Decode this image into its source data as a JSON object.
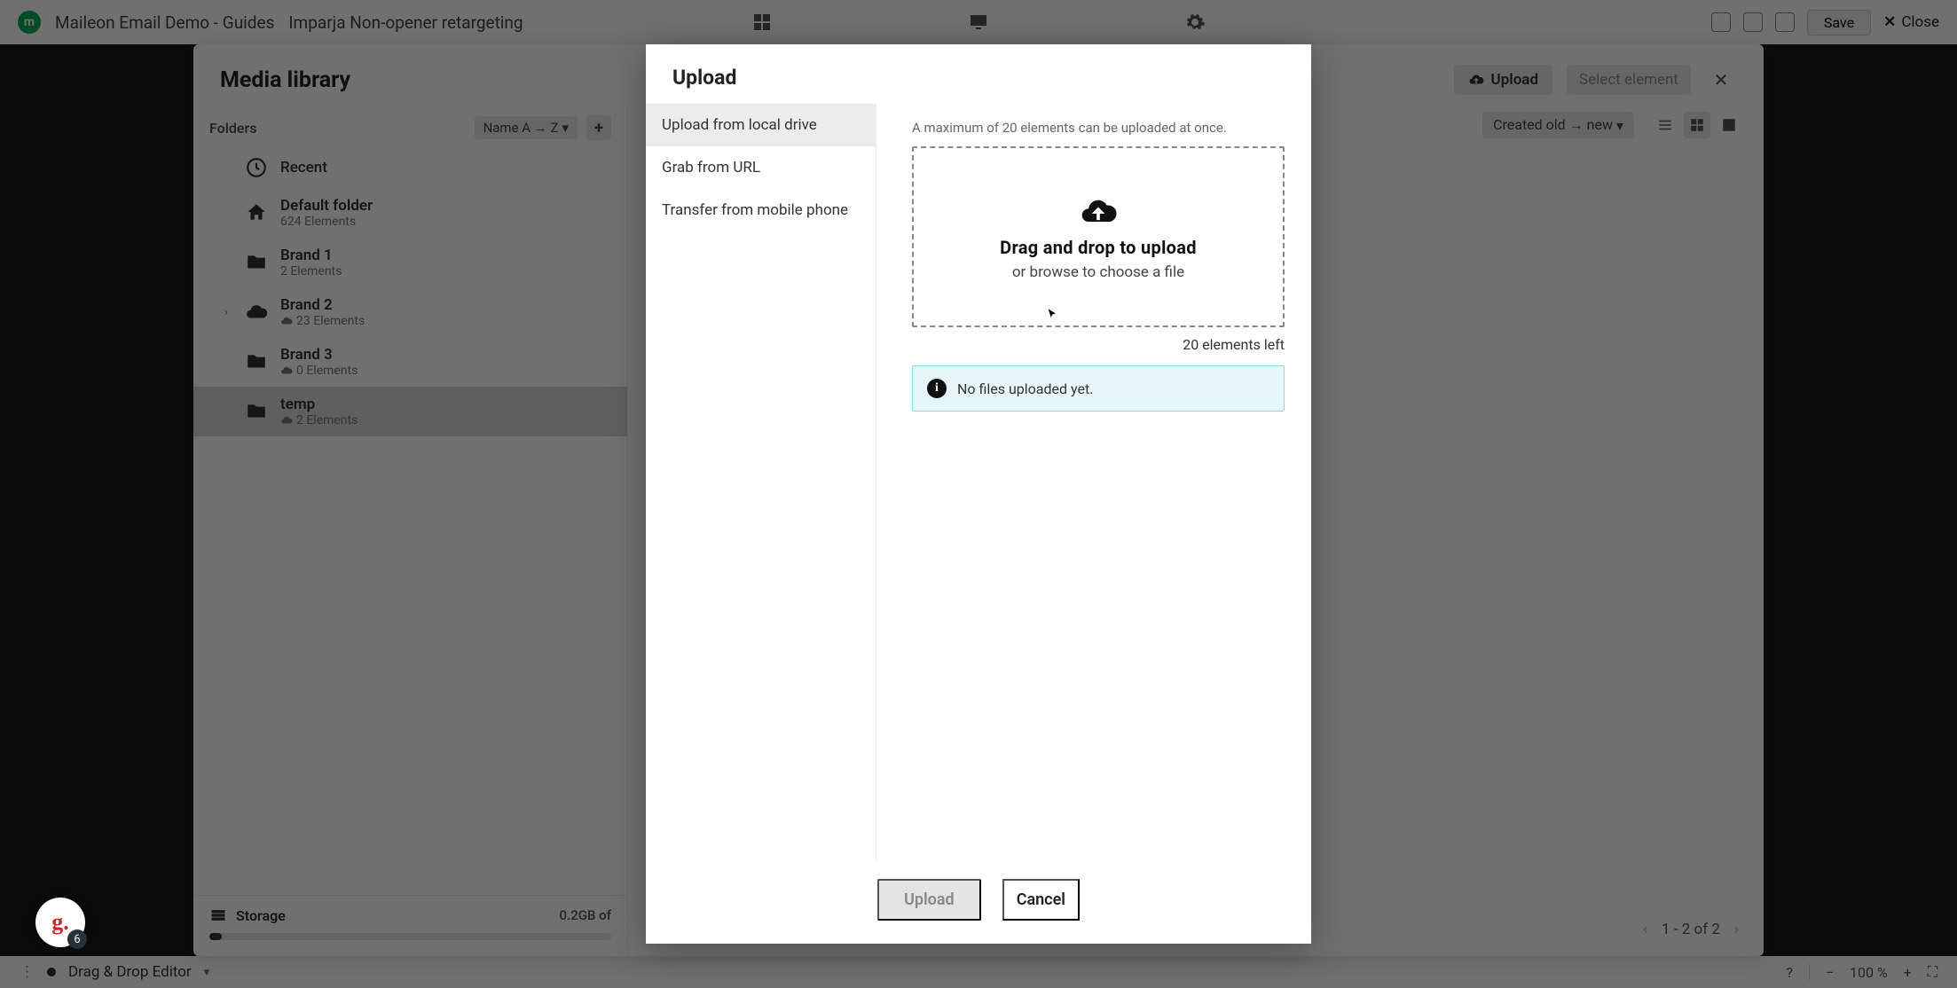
{
  "topbar": {
    "crumb1": "Maileon Email Demo - Guides",
    "crumb2": "Imparja Non-opener retargeting",
    "save": "Save",
    "close": "Close"
  },
  "bottombar": {
    "editor": "Drag & Drop Editor",
    "zoom": "100 %"
  },
  "panel": {
    "title": "Media library",
    "upload_btn": "Upload",
    "select_btn": "Select element"
  },
  "sidebar": {
    "folders_label": "Folders",
    "sort": "Name A → Z",
    "recent": "Recent",
    "items": [
      {
        "name": "Default folder",
        "meta": "624 Elements",
        "icon": "home"
      },
      {
        "name": "Brand 1",
        "meta": "2 Elements",
        "icon": "folder"
      },
      {
        "name": "Brand 2",
        "meta": "23 Elements",
        "icon": "cloud",
        "expandable": true
      },
      {
        "name": "Brand 3",
        "meta": "0 Elements",
        "icon": "folder"
      },
      {
        "name": "temp",
        "meta": "2 Elements",
        "icon": "folder",
        "selected": true
      }
    ],
    "storage_label": "Storage",
    "storage_value": "0.2GB of"
  },
  "content": {
    "sort": "Created old → new",
    "empty": "",
    "pager": "1 - 2  of  2"
  },
  "modal": {
    "title": "Upload",
    "tabs": {
      "local": "Upload from local drive",
      "url": "Grab from URL",
      "mobile": "Transfer from mobile phone"
    },
    "hint": "A maximum of 20 elements can be uploaded at once.",
    "dz_title": "Drag and drop to upload",
    "dz_sub": "or browse to choose a file",
    "left": "20 elements left",
    "info": "No files uploaded yet.",
    "upload": "Upload",
    "cancel": "Cancel"
  },
  "gbadge": {
    "count": "6"
  }
}
